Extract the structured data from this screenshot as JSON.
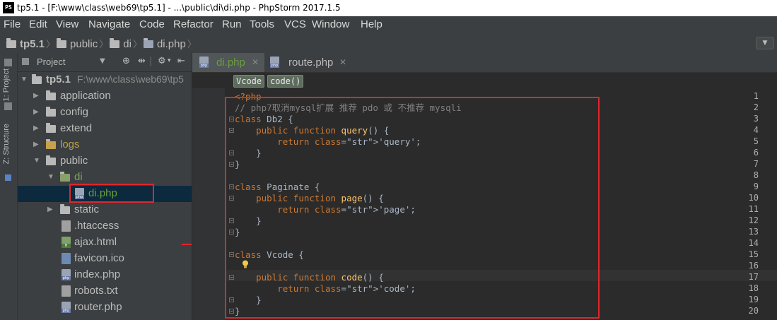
{
  "window": {
    "app_icon": "PS",
    "title": "tp5.1 - [F:\\www\\class\\web69\\tp5.1] - ...\\public\\di\\di.php - PhpStorm 2017.1.5"
  },
  "menu": [
    "File",
    "Edit",
    "View",
    "Navigate",
    "Code",
    "Refactor",
    "Run",
    "Tools",
    "VCS",
    "Window",
    "Help"
  ],
  "breadcrumbs": [
    "tp5.1",
    "public",
    "di",
    "di.php"
  ],
  "side_tabs": {
    "project": "1: Project",
    "structure": "Z: Structure"
  },
  "project_panel": {
    "title": "Project",
    "tree": [
      {
        "label": "tp5.1",
        "path": "F:\\www\\class\\web69\\tp5"
      },
      {
        "label": "application"
      },
      {
        "label": "config"
      },
      {
        "label": "extend"
      },
      {
        "label": "logs"
      },
      {
        "label": "public"
      },
      {
        "label": "di"
      },
      {
        "label": "di.php"
      },
      {
        "label": "static"
      },
      {
        "label": ".htaccess"
      },
      {
        "label": "ajax.html"
      },
      {
        "label": "favicon.ico"
      },
      {
        "label": "index.php"
      },
      {
        "label": "robots.txt"
      },
      {
        "label": "router.php"
      }
    ]
  },
  "editor": {
    "tabs": [
      {
        "label": "di.php",
        "active": true
      },
      {
        "label": "route.php",
        "active": false
      }
    ],
    "struct_crumbs": [
      "Vcode",
      "code()"
    ],
    "line_numbers": [
      "1",
      "2",
      "3",
      "4",
      "5",
      "6",
      "7",
      "8",
      "9",
      "10",
      "11",
      "12",
      "13",
      "14",
      "15",
      "16",
      "17",
      "18",
      "19",
      "20"
    ],
    "lines": [
      "<?php",
      "// php7取消mysql扩展 推荐 pdo 或 不推荐 mysqli",
      "class Db2 {",
      "    public function query() {",
      "        return 'query';",
      "    }",
      "}",
      "",
      "class Paginate {",
      "    public function page() {",
      "        return 'page';",
      "    }",
      "}",
      "",
      "class Vcode {",
      "",
      "    public function code() {",
      "        return 'code';",
      "    }",
      "}"
    ]
  },
  "colors": {
    "keyword": "#cc7832",
    "function": "#ffc66d",
    "string": "#6a8759",
    "comment": "#808080",
    "highlight": "#e0262b"
  }
}
